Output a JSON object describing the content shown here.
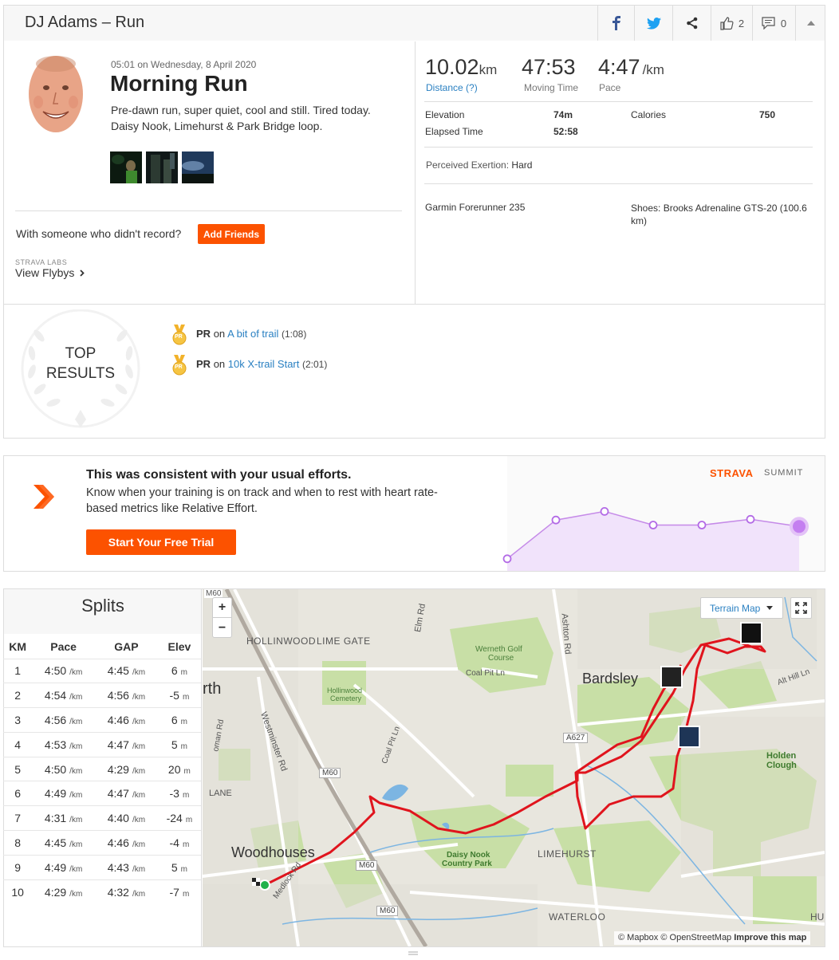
{
  "header": {
    "title": "DJ Adams – Run",
    "kudos_count": "2",
    "comment_count": "0"
  },
  "activity": {
    "datetime": "05:01 on Wednesday, 8 April 2020",
    "name": "Morning Run",
    "description_line1": "Pre-dawn run, super quiet, cool and still. Tired today.",
    "description_line2": "Daisy Nook, Limehurst & Park Bridge loop.",
    "record_prompt": "With someone who didn't record?",
    "add_friends_label": "Add Friends",
    "labs_label": "STRAVA LABS",
    "flybys_label": "View Flybys"
  },
  "stats": {
    "distance_value": "10.02",
    "distance_unit": "km",
    "distance_label": "Distance (?)",
    "moving_time_value": "47:53",
    "moving_time_label": "Moving Time",
    "pace_value": "4:47",
    "pace_unit": "/km",
    "pace_label": "Pace",
    "elevation_label": "Elevation",
    "elevation_value": "74m",
    "calories_label": "Calories",
    "calories_value": "750",
    "elapsed_label": "Elapsed Time",
    "elapsed_value": "52:58",
    "exertion_label": "Perceived Exertion:",
    "exertion_value": "Hard",
    "device": "Garmin Forerunner 235",
    "shoes_line1": "Shoes: Brooks Adrenaline GTS-20 (100.6",
    "shoes_line2": "km)"
  },
  "top_results": {
    "title_line1": "TOP",
    "title_line2": "RESULTS",
    "items": [
      {
        "badge": "PR",
        "pr": "PR",
        "on": "on",
        "segment": "A bit of trail",
        "time": "(1:08)"
      },
      {
        "badge": "PR",
        "pr": "PR",
        "on": "on",
        "segment": "10k X-trail Start",
        "time": "(2:01)"
      }
    ]
  },
  "summit": {
    "headline": "This was consistent with your usual efforts.",
    "body_line1": "Know when your training is on track and when to rest with heart rate-",
    "body_line2": "based metrics like Relative Effort.",
    "cta": "Start Your Free Trial",
    "brand": "STRAVA",
    "brand_suffix": "SUMMIT",
    "effort_points": [
      0.08,
      0.62,
      0.74,
      0.55,
      0.55,
      0.63,
      0.53
    ]
  },
  "splits": {
    "title": "Splits",
    "headers": [
      "KM",
      "Pace",
      "GAP",
      "Elev"
    ],
    "unit": "/km",
    "elev_unit": "m",
    "rows": [
      {
        "km": "1",
        "pace": "4:50",
        "gap": "4:45",
        "elev": "6"
      },
      {
        "km": "2",
        "pace": "4:54",
        "gap": "4:56",
        "elev": "-5"
      },
      {
        "km": "3",
        "pace": "4:56",
        "gap": "4:46",
        "elev": "6"
      },
      {
        "km": "4",
        "pace": "4:53",
        "gap": "4:47",
        "elev": "5"
      },
      {
        "km": "5",
        "pace": "4:50",
        "gap": "4:29",
        "elev": "20"
      },
      {
        "km": "6",
        "pace": "4:49",
        "gap": "4:47",
        "elev": "-3"
      },
      {
        "km": "7",
        "pace": "4:31",
        "gap": "4:40",
        "elev": "-24"
      },
      {
        "km": "8",
        "pace": "4:45",
        "gap": "4:46",
        "elev": "-4"
      },
      {
        "km": "9",
        "pace": "4:49",
        "gap": "4:43",
        "elev": "5"
      },
      {
        "km": "10",
        "pace": "4:29",
        "gap": "4:32",
        "elev": "-7"
      }
    ]
  },
  "map": {
    "terrain_label": "Terrain Map",
    "zoom_in": "+",
    "zoom_out": "−",
    "attribution_mapbox": "© Mapbox",
    "attribution_osm": "© OpenStreetMap",
    "improve": "Improve this map",
    "labels": {
      "m60_top": "M60",
      "hollinwood": "HOLLINWOOD",
      "lime_gate": "LIME GATE",
      "elm_rd": "Elm Rd",
      "ashton_rd": "Ashton Rd",
      "werneth": "Werneth Golf",
      "course": "Course",
      "coal_pit": "Coal Pit Ln",
      "coal_pit_v": "Coal Pit Ln",
      "cemetery1": "Hollinwood",
      "cemetery2": "Cemetery",
      "bardsley": "Bardsley",
      "westminster": "Westminster Rd",
      "rth": "rth",
      "oman_rd": "oman Rd",
      "a627": "A627",
      "m60_mid": "M60",
      "m60_low": "M60",
      "m60_bot": "M60",
      "alt_hill": "Alt Hill Ln",
      "holden": "Holden Clough",
      "lane": "LANE",
      "daisy1": "Daisy Nook",
      "daisy2": "Country Park",
      "limehurst": "LIMEHURST",
      "woodhouses": "Woodhouses",
      "medlock": "Medlock Rd",
      "waterloo": "WATERLOO",
      "hu": "HU"
    }
  },
  "colors": {
    "accent": "#fc5200",
    "link": "#2a80c2",
    "route": "#e0141d",
    "summit_purple": "#b36be6"
  }
}
